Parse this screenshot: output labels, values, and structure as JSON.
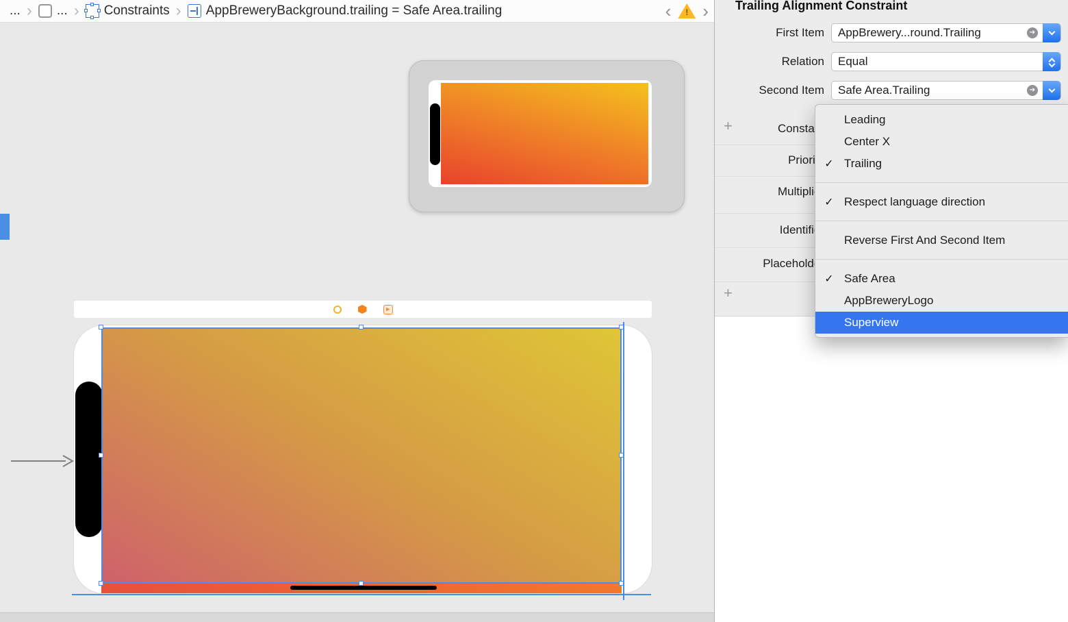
{
  "breadcrumb": {
    "item1": "...",
    "item2": "...",
    "item3": "Constraints",
    "item4": "AppBreweryBackground.trailing = Safe Area.trailing"
  },
  "nav": {
    "crumb_sep": "›",
    "back": "‹",
    "forward": "›",
    "warning_mark": "!"
  },
  "inspector": {
    "title": "Trailing Alignment Constraint",
    "first_item_label": "First Item",
    "first_item_value": "AppBrewery...round.Trailing",
    "relation_label": "Relation",
    "relation_value": "Equal",
    "second_item_label": "Second Item",
    "second_item_value": "Safe Area.Trailing",
    "row_constant": "Constant",
    "row_priority": "Priority",
    "row_multiplier": "Multiplier",
    "row_identifier": "Identifier",
    "row_placeholder": "Placeholder",
    "plus": "+",
    "nav_arrow": "➔"
  },
  "menu": {
    "groups": [
      {
        "items": [
          {
            "label": "Leading"
          },
          {
            "label": "Center X"
          },
          {
            "label": "Trailing",
            "check": "✓"
          }
        ]
      },
      {
        "items": [
          {
            "label": "Respect language direction",
            "check": "✓"
          }
        ]
      },
      {
        "items": [
          {
            "label": "Reverse First And Second Item"
          }
        ]
      },
      {
        "items": [
          {
            "label": "Safe Area",
            "check": "✓"
          },
          {
            "label": "AppBreweryLogo"
          },
          {
            "label": "Superview",
            "selected": true
          }
        ]
      }
    ]
  },
  "colors": {
    "menu_selection_blue": "#3576f0",
    "dropdown_button_blue": "#2071ee",
    "selection_outline_blue": "#4a8de2",
    "screen_gradient_top": "#dfc636",
    "screen_gradient_bottom": "#ce616b",
    "preview_gradient_top": "#f4c11d",
    "preview_gradient_bottom": "#e8432c",
    "bottom_strip_orange": "#e7513b",
    "warning_yellow": "#fcb827"
  }
}
